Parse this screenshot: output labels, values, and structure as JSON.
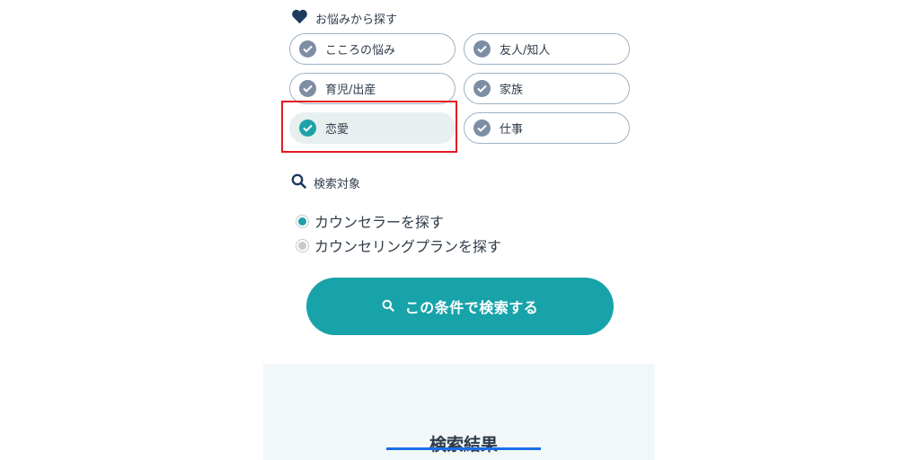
{
  "concerns": {
    "heading": "お悩みから探す",
    "chips": [
      {
        "label": "こころの悩み",
        "selected": false
      },
      {
        "label": "友人/知人",
        "selected": false
      },
      {
        "label": "育児/出産",
        "selected": false
      },
      {
        "label": "家族",
        "selected": false
      },
      {
        "label": "恋愛",
        "selected": true
      },
      {
        "label": "仕事",
        "selected": false
      }
    ]
  },
  "target": {
    "heading": "検索対象",
    "options": [
      {
        "label": "カウンセラーを探す",
        "checked": true
      },
      {
        "label": "カウンセリングプランを探す",
        "checked": false
      }
    ]
  },
  "search_button": {
    "label": "この条件で検索する"
  },
  "results": {
    "title": "検索結果"
  },
  "colors": {
    "accent": "#18a3aa",
    "highlight_box": "#e41b23",
    "underline": "#1a6ee8",
    "text": "#2f3b4a"
  },
  "icons": {
    "concerns_heading": "heart-icon",
    "target_heading": "search-icon",
    "chip_check": "check-circle-icon",
    "button": "search-icon"
  }
}
